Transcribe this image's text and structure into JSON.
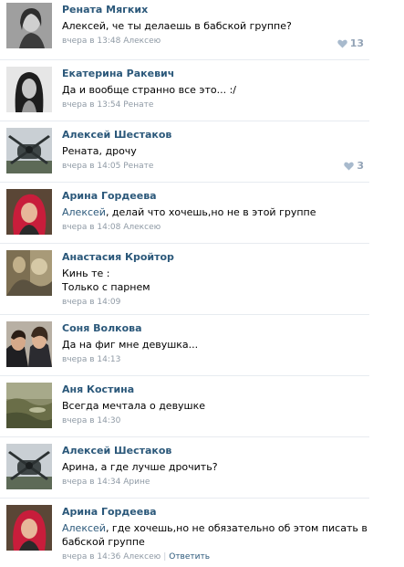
{
  "colors": {
    "author": "#2b587a",
    "meta": "#8f9aa5",
    "like": "#a8bacd",
    "divider": "#e7ebf0"
  },
  "comments": [
    {
      "author": "Рената Мягких",
      "reply_to": "",
      "lines": [
        "Алексей, че ты делаешь в бабской группе?"
      ],
      "time": "вчера в 13:48",
      "reply_to_name": "Алексею",
      "likes": "13",
      "avatar_icon": "avatar-woman-photo"
    },
    {
      "author": "Екатерина Ракевич",
      "reply_to": "",
      "lines": [
        "Да и вообще странно все это... :/"
      ],
      "time": "вчера в 13:54",
      "reply_to_name": "Ренате",
      "likes": "",
      "avatar_icon": "avatar-girl-photo"
    },
    {
      "author": "Алексей Шестаков",
      "reply_to": "",
      "lines": [
        "Рената, дрочу"
      ],
      "time": "вчера в 14:05",
      "reply_to_name": "Ренате",
      "likes": "3",
      "avatar_icon": "avatar-airplane-photo"
    },
    {
      "author": "Арина Гордеева",
      "reply_to": "Алексей",
      "lines": [
        ", делай что хочешь,но не в этой группе"
      ],
      "time": "вчера в 14:08",
      "reply_to_name": "Алексею",
      "likes": "",
      "avatar_icon": "avatar-redhair-photo"
    },
    {
      "author": "Анастасия Кройтор",
      "reply_to": "",
      "lines": [
        "Кинь те :",
        "Только с парнем"
      ],
      "time": "вчера в 14:09",
      "reply_to_name": "",
      "likes": "",
      "avatar_icon": "avatar-photo"
    },
    {
      "author": "Соня Волкова",
      "reply_to": "",
      "lines": [
        "Да на фиг мне девушка..."
      ],
      "time": "вчера в 14:13",
      "reply_to_name": "",
      "likes": "",
      "avatar_icon": "avatar-two-men-photo"
    },
    {
      "author": "Аня Костина",
      "reply_to": "",
      "lines": [
        "Всегда мечтала о девушке"
      ],
      "time": "вчера в 14:30",
      "reply_to_name": "",
      "likes": "",
      "avatar_icon": "avatar-landscape-photo"
    },
    {
      "author": "Алексей Шестаков",
      "reply_to": "",
      "lines": [
        "Арина, а где лучше дрочить?"
      ],
      "time": "вчера в 14:34",
      "reply_to_name": "Арине",
      "likes": "",
      "avatar_icon": "avatar-airplane-photo"
    },
    {
      "author": "Арина Гордеева",
      "reply_to": "Алексей",
      "lines": [
        ", где хочешь,но не обязательно об этом писать в",
        "бабской группе"
      ],
      "time": "вчера в 14:36",
      "reply_to_name": "Алексею",
      "reply_label": "Ответить",
      "likes": "",
      "avatar_icon": "avatar-redhair-photo"
    }
  ]
}
